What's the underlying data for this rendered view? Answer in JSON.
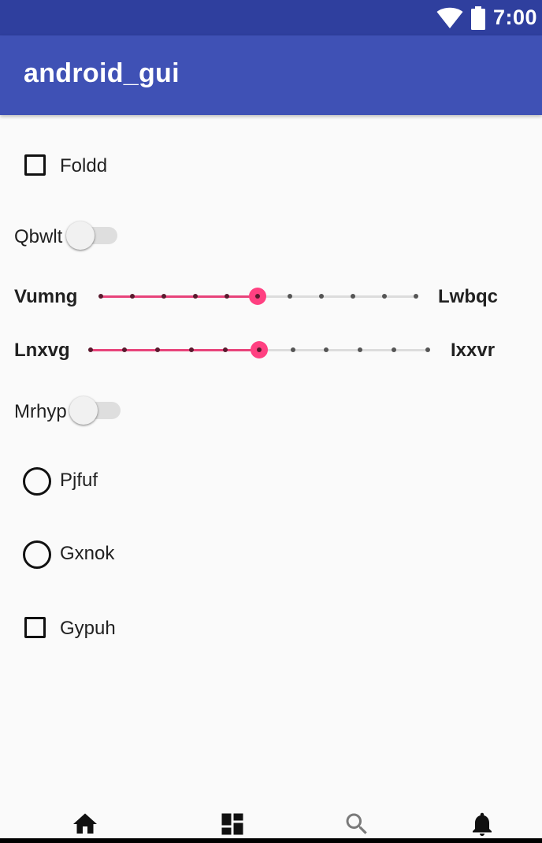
{
  "status_bar": {
    "time": "7:00",
    "icons": [
      "wifi-icon",
      "battery-icon"
    ]
  },
  "app_bar": {
    "title": "android_gui"
  },
  "controls": {
    "checkbox_foldd": {
      "label": "Foldd",
      "checked": false
    },
    "switch_qbwlt": {
      "label": "Qbwlt",
      "on": false
    },
    "slider_1": {
      "left_label": "Vumng",
      "right_label": "Lwbqc",
      "steps": 10,
      "value": 5
    },
    "slider_2": {
      "left_label": "Lnxvg",
      "right_label": "Ixxvr",
      "steps": 10,
      "value": 5
    },
    "switch_mrhyp": {
      "label": "Mrhyp",
      "on": false
    },
    "radio_pjfuf": {
      "label": "Pjfuf",
      "selected": false
    },
    "radio_gxnok": {
      "label": "Gxnok",
      "selected": false
    },
    "checkbox_gypuh": {
      "label": "Gypuh",
      "checked": false
    }
  },
  "bottom_nav": {
    "items": [
      "home-icon",
      "dashboard-icon",
      "search-icon",
      "notifications-icon"
    ]
  },
  "colors": {
    "status_bar": "#2f3f9e",
    "app_bar": "#3f51b5",
    "accent": "#ff4081",
    "background": "#fafafa"
  }
}
